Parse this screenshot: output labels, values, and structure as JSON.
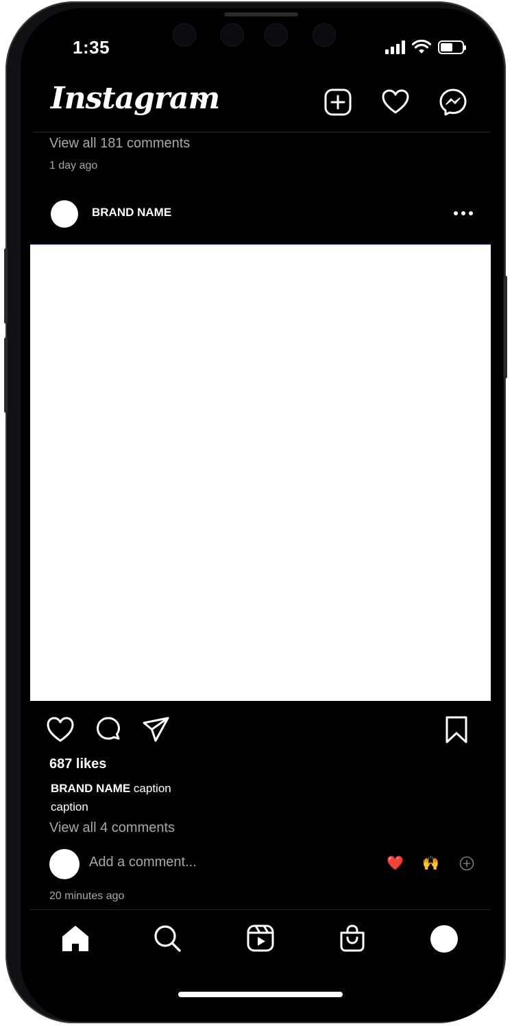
{
  "status_bar": {
    "time": "1:35"
  },
  "header": {
    "logo_text": "Instagram"
  },
  "previous_post": {
    "view_comments": "View all 181 comments",
    "time_ago": "1 day ago"
  },
  "post": {
    "username": "BRAND NAME",
    "likes": "687 likes",
    "caption_user": "BRAND NAME",
    "caption_line1": "caption",
    "caption_line2": "caption",
    "view_comments": "View all 4 comments",
    "comment_placeholder": "Add a comment...",
    "quick_emojis": [
      "❤️",
      "🙌"
    ],
    "time_ago": "20 minutes ago",
    "image_color": "#ffffff"
  },
  "icons": {
    "header": [
      "new-post-icon",
      "heart-icon",
      "messenger-icon"
    ],
    "actions": [
      "like-icon",
      "comment-icon",
      "share-icon",
      "bookmark-icon"
    ],
    "tabs": [
      "home-icon",
      "search-icon",
      "reels-icon",
      "shop-icon",
      "profile-avatar"
    ]
  },
  "colors": {
    "background": "#000000",
    "text": "#ffffff",
    "secondary_text": "#a8a8a8"
  }
}
